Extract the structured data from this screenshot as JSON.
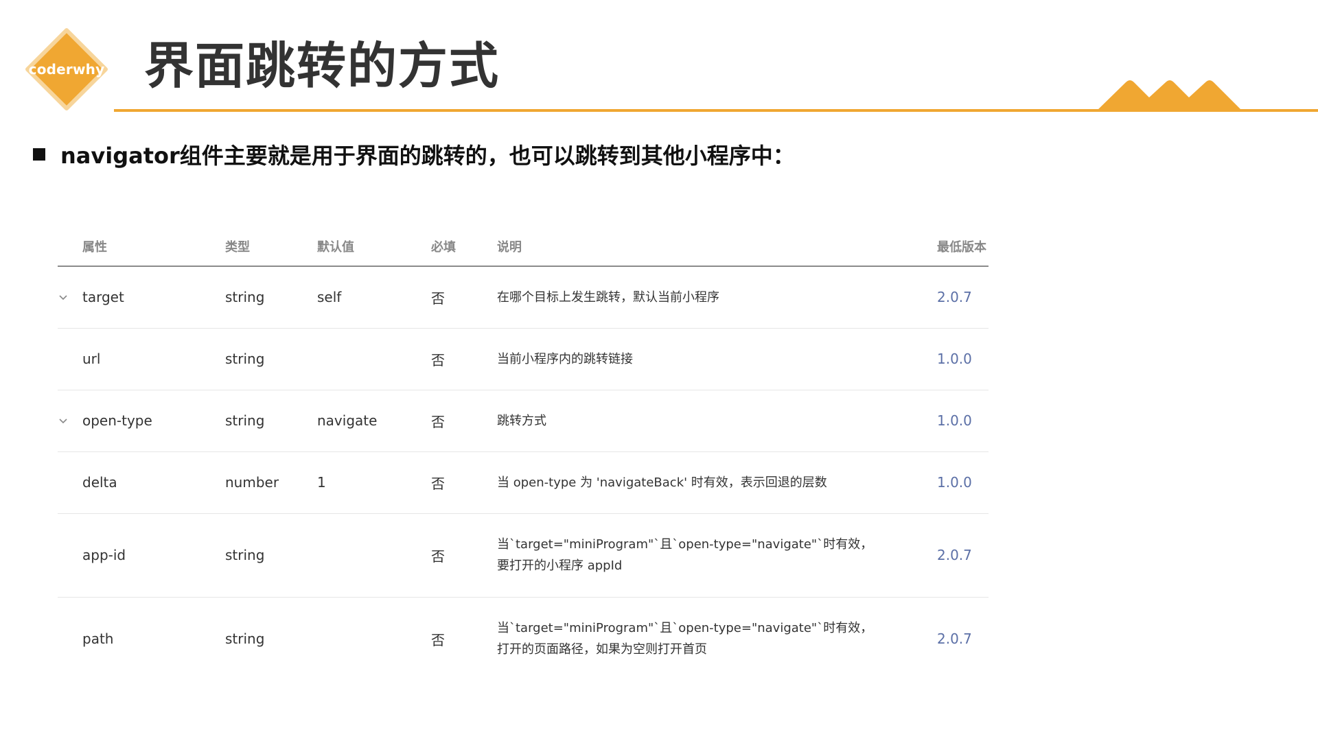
{
  "header": {
    "logo_text": "coderwhy",
    "title": "界面跳转的方式"
  },
  "bullet": {
    "text": "navigator组件主要就是用于界面的跳转的，也可以跳转到其他小程序中："
  },
  "table": {
    "columns": {
      "attr": "属性",
      "type": "类型",
      "default": "默认值",
      "required": "必填",
      "desc": "说明",
      "version": "最低版本"
    },
    "rows": [
      {
        "name": "target",
        "type": "string",
        "default": "self",
        "required": "否",
        "desc": [
          "在哪个目标上发生跳转，默认当前小程序"
        ],
        "version": "2.0.7",
        "expandable": true
      },
      {
        "name": "url",
        "type": "string",
        "default": "",
        "required": "否",
        "desc": [
          "当前小程序内的跳转链接"
        ],
        "version": "1.0.0",
        "expandable": false
      },
      {
        "name": "open-type",
        "type": "string",
        "default": "navigate",
        "required": "否",
        "desc": [
          "跳转方式"
        ],
        "version": "1.0.0",
        "expandable": true
      },
      {
        "name": "delta",
        "type": "number",
        "default": "1",
        "required": "否",
        "desc": [
          "当 open-type 为 'navigateBack' 时有效，表示回退的层数"
        ],
        "version": "1.0.0",
        "expandable": false
      },
      {
        "name": "app-id",
        "type": "string",
        "default": "",
        "required": "否",
        "desc": [
          "当`target=\"miniProgram\"`且`open-type=\"navigate\"`时有效，",
          "要打开的小程序 appId"
        ],
        "version": "2.0.7",
        "expandable": false
      },
      {
        "name": "path",
        "type": "string",
        "default": "",
        "required": "否",
        "desc": [
          "当`target=\"miniProgram\"`且`open-type=\"navigate\"`时有效，",
          "打开的页面路径，如果为空则打开首页"
        ],
        "version": "2.0.7",
        "expandable": false
      }
    ]
  },
  "colors": {
    "accent": "#F0A732",
    "version_link": "#5b6fa6",
    "title": "#333333"
  },
  "icons": {
    "logo": "diamond-logo",
    "expand": "chevron-down-icon",
    "bullet": "square-bullet"
  }
}
